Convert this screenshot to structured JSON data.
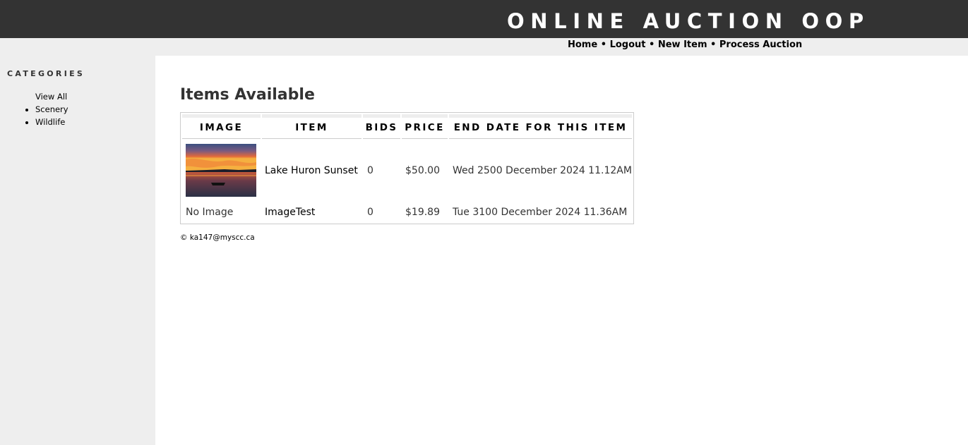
{
  "header": {
    "site_title": "ONLINE AUCTION OOP"
  },
  "nav": {
    "items": [
      "Home",
      "Logout",
      "New Item",
      "Process Auction"
    ],
    "separator": "•"
  },
  "sidebar": {
    "heading": "CATEGORIES",
    "items": [
      {
        "label": "View All"
      },
      {
        "label": "Scenery"
      },
      {
        "label": "Wildlife"
      }
    ]
  },
  "main": {
    "title": "Items Available",
    "table": {
      "columns": [
        "IMAGE",
        "ITEM",
        "BIDS",
        "PRICE",
        "END DATE FOR THIS ITEM"
      ],
      "rows": [
        {
          "image": "sunset-photo",
          "item": "Lake Huron Sunset",
          "bids": "0",
          "price": "$50.00",
          "end_date": "Wed 2500 December 2024 11.12AM"
        },
        {
          "image": "No Image",
          "item": "ImageTest",
          "bids": "0",
          "price": "$19.89",
          "end_date": "Tue 3100 December 2024 11.36AM"
        }
      ]
    }
  },
  "footer": {
    "text": "© ka147@myscc.ca"
  }
}
